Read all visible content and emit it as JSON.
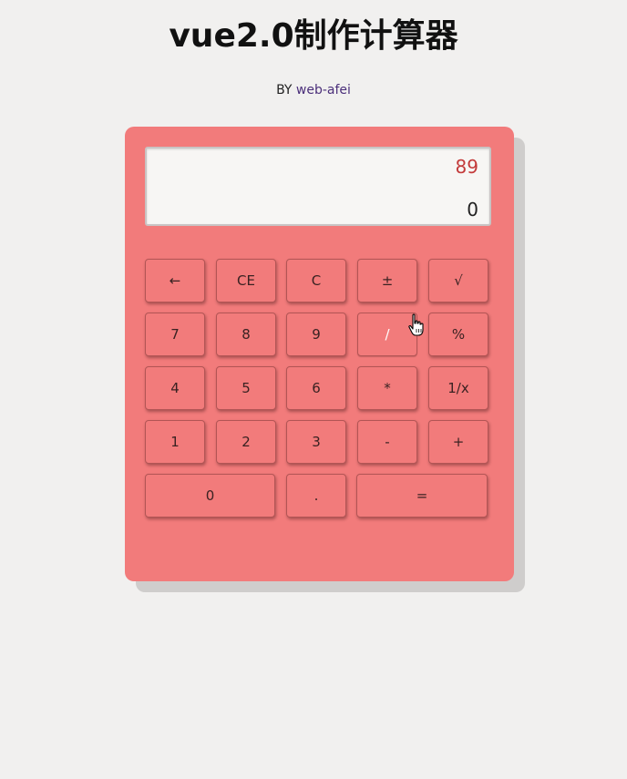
{
  "page": {
    "title": "vue2.0制作计算器",
    "by_prefix": "BY",
    "author": "web-afei"
  },
  "display": {
    "expression": "89",
    "result": "0"
  },
  "buttons": {
    "backspace": "←",
    "ce": "CE",
    "clear": "C",
    "plus_minus": "±",
    "sqrt": "√",
    "seven": "7",
    "eight": "8",
    "nine": "9",
    "divide": "/",
    "percent": "%",
    "four": "4",
    "five": "5",
    "six": "6",
    "multiply": "*",
    "reciprocal": "1/x",
    "one": "1",
    "two": "2",
    "three": "3",
    "minus": "-",
    "plus": "+",
    "zero": "0",
    "decimal": ".",
    "equals": "="
  },
  "colors": {
    "calculator_body": "#f27b7b",
    "page_background": "#f1f0ef",
    "expression_text": "#c33a3a",
    "author_link": "#4b2f7a"
  },
  "cursor_icon": "hand-pointer-icon"
}
